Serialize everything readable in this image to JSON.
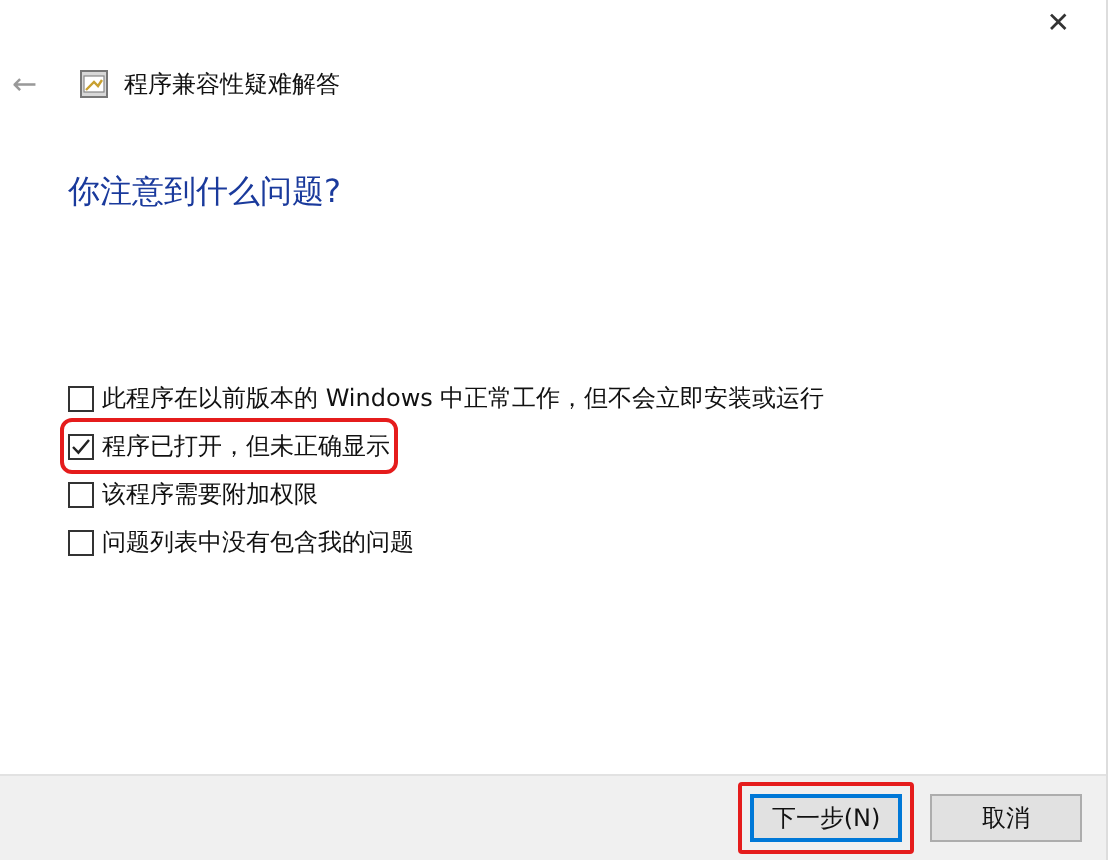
{
  "window": {
    "close": "✕"
  },
  "header": {
    "back": "←",
    "title": "程序兼容性疑难解答"
  },
  "heading": "你注意到什么问题?",
  "options": [
    {
      "label": "此程序在以前版本的 Windows 中正常工作，但不会立即安装或运行",
      "checked": false,
      "highlighted": false
    },
    {
      "label": "程序已打开，但未正确显示",
      "checked": true,
      "highlighted": true
    },
    {
      "label": "该程序需要附加权限",
      "checked": false,
      "highlighted": false
    },
    {
      "label": "问题列表中没有包含我的问题",
      "checked": false,
      "highlighted": false
    }
  ],
  "buttons": [
    {
      "label": "下一步(N)",
      "default": true,
      "highlighted": true
    },
    {
      "label": "取消",
      "default": false,
      "highlighted": false
    }
  ]
}
